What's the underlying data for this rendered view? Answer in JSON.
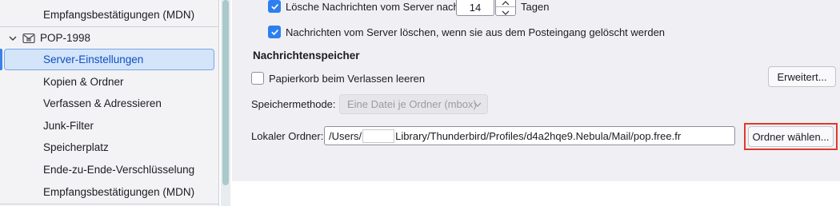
{
  "sidebar": {
    "items_top": [
      {
        "label": "Empfangsbestätigungen (MDN)"
      }
    ],
    "account": {
      "name": "POP-1998",
      "icon": "mail-account-icon",
      "expand_icon": "chevron-down-icon"
    },
    "items": [
      {
        "label": "Server-Einstellungen",
        "selected": true
      },
      {
        "label": "Kopien & Ordner"
      },
      {
        "label": "Verfassen & Adressieren"
      },
      {
        "label": "Junk-Filter"
      },
      {
        "label": "Speicherplatz"
      },
      {
        "label": "Ende-zu-Ende-Verschlüsselung"
      },
      {
        "label": "Empfangsbestätigungen (MDN)"
      }
    ]
  },
  "settings": {
    "delete_after": {
      "label_before": "Lösche Nachrichten vom Server nach",
      "value": "14",
      "label_after": "Tagen",
      "checked": true
    },
    "delete_when_removed": {
      "label": "Nachrichten vom Server löschen, wenn sie aus dem Posteingang gelöscht werden",
      "checked": true
    },
    "storage_heading": "Nachrichtenspeicher",
    "empty_trash": {
      "label": "Papierkorb beim Verlassen leeren",
      "checked": false
    },
    "advanced_button": "Erweitert...",
    "storage_method": {
      "label": "Speichermethode:",
      "value": "Eine Datei je Ordner (mbox)"
    },
    "local_folder": {
      "label": "Lokaler Ordner:",
      "path_start": "/Users/",
      "path_end": "Library/Thunderbird/Profiles/d4a2hqe9.Nebula/Mail/pop.free.fr"
    },
    "choose_folder_button": "Ordner wählen..."
  },
  "colors": {
    "accent": "#2d7ff0",
    "selection_bg": "#d4e4f9",
    "highlight_border": "#e0392b"
  }
}
